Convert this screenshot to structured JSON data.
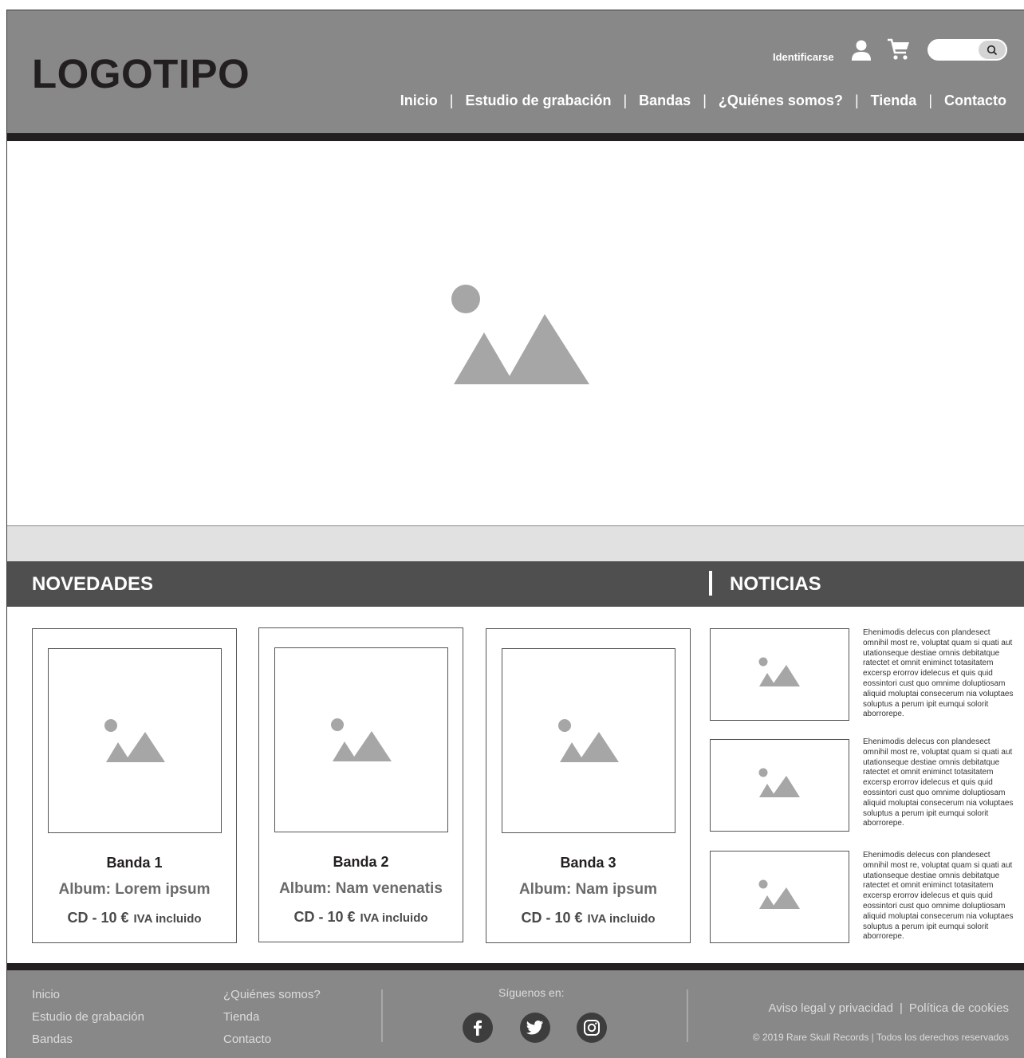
{
  "header": {
    "logo": "LOGOTIPO",
    "login_label": "Identificarse",
    "nav": [
      "Inicio",
      "Estudio de grabación",
      "Bandas",
      "¿Quiénes somos?",
      "Tienda",
      "Contacto"
    ],
    "nav_separator": "|"
  },
  "sections": {
    "novedades": "NOVEDADES",
    "noticias": "NOTICIAS"
  },
  "products": [
    {
      "band": "Banda 1",
      "album": "Album: Lorem ipsum",
      "price": "CD - 10 €",
      "tax": "IVA incluido"
    },
    {
      "band": "Banda 2",
      "album": "Album: Nam venenatis",
      "price": "CD - 10 €",
      "tax": "IVA incluido"
    },
    {
      "band": "Banda 3",
      "album": "Album: Nam ipsum",
      "price": "CD - 10 €",
      "tax": "IVA incluido"
    }
  ],
  "news": [
    {
      "text": "Ehenimodis delecus con plandesect omnihil most re, voluptat quam si quati aut utationseque destiae omnis debitatque ratectet et omnit eniminct totasitatem excersp erorrov idelecus et quis quid eossintori cust quo omnime doluptiosam aliquid moluptai consecerum nia voluptaes soluptus a perum ipit eumqui solorit aborrorepe."
    },
    {
      "text": "Ehenimodis delecus con plandesect omnihil most re, voluptat quam si quati aut utationseque destiae omnis debitatque ratectet et omnit eniminct totasitatem excersp erorrov idelecus et quis quid eossintori cust quo omnime doluptiosam aliquid moluptai consecerum nia voluptaes soluptus a perum ipit eumqui solorit aborrorepe."
    },
    {
      "text": "Ehenimodis delecus con plandesect omnihil most re, voluptat quam si quati aut utationseque destiae omnis debitatque ratectet et omnit eniminct totasitatem excersp erorrov idelecus et quis quid eossintori cust quo omnime doluptiosam aliquid moluptai consecerum nia voluptaes soluptus a perum ipit eumqui solorit aborrorepe."
    }
  ],
  "footer": {
    "links_col1": [
      "Inicio",
      "Estudio de grabación",
      "Bandas"
    ],
    "links_col2": [
      "¿Quiénes somos?",
      "Tienda",
      "Contacto"
    ],
    "follow": "Síguenos en:",
    "social_icons": [
      "facebook-icon",
      "twitter-icon",
      "instagram-icon"
    ],
    "legal": "Aviso legal y privacidad",
    "legal_separator": "|",
    "cookies": "Política de cookies",
    "copyright": "© 2019 Rare Skull Records | Todos los derechos reservados"
  },
  "colors": {
    "header_bg": "#888888",
    "dark_bar": "#231f20",
    "section_bar": "#4f4f4f",
    "placeholder_gray": "#a6a6a6",
    "band_gray": "#e1e1e1"
  }
}
